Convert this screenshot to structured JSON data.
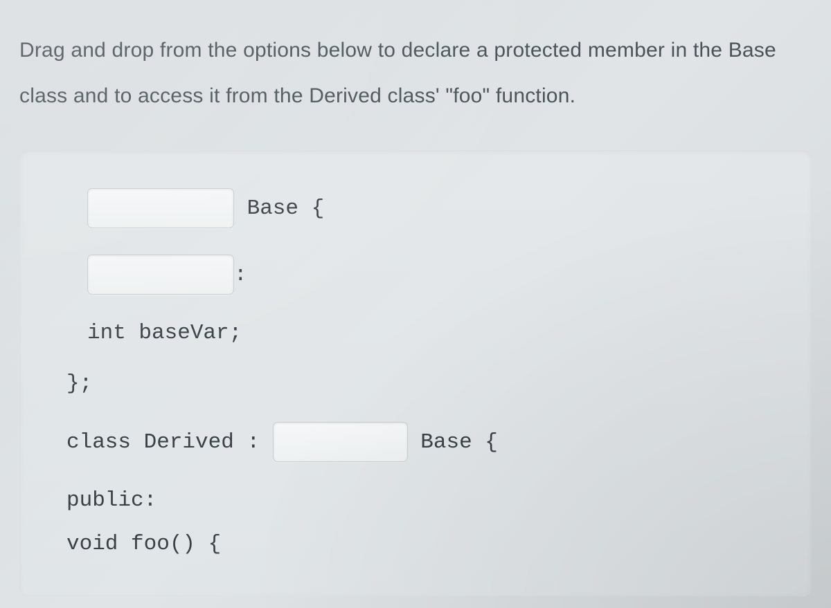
{
  "instruction": "Drag and drop from the options below to declare a protected member in the Base class and to access it from the Derived class' \"foo\" function.",
  "code": {
    "line1_after": " Base {",
    "line2_after": ":",
    "line3": "int baseVar;",
    "line4": "};",
    "line5_before": "class Derived : ",
    "line5_after": " Base {",
    "line6": "public:",
    "line7": "void foo() {"
  }
}
